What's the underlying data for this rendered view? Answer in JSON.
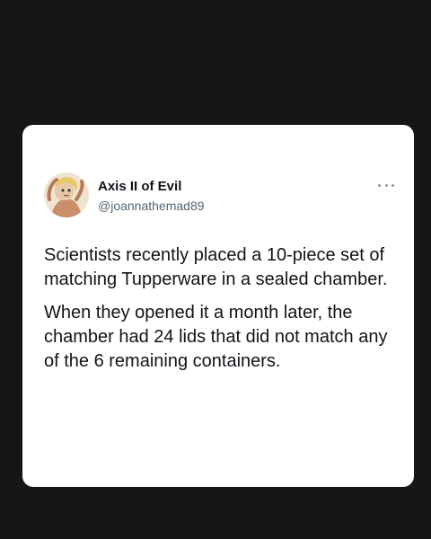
{
  "tweet": {
    "display_name": "Axis II of Evil",
    "handle": "@joannathemad89",
    "paragraphs": [
      "Scientists recently placed a 10-piece set of matching Tupperware in a sealed chamber.",
      "When they opened it a month later, the chamber had 24 lids that did not match any of the 6 remaining containers."
    ]
  },
  "icons": {
    "avatar": "avatar-illustration",
    "more": "more-options-icon"
  },
  "colors": {
    "background": "#161616",
    "card": "#ffffff",
    "text": "#0f1419",
    "secondary_text": "#536471"
  }
}
